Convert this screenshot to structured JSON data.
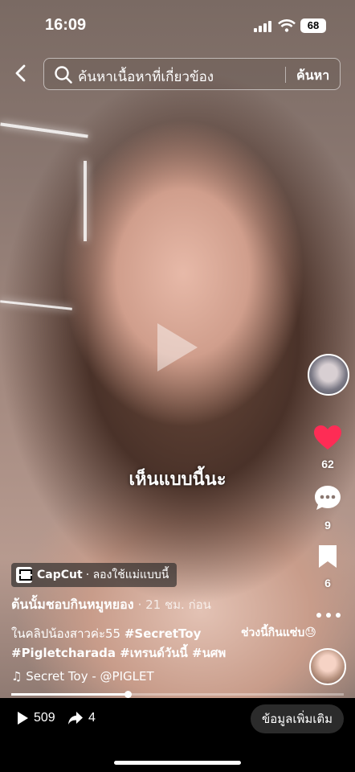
{
  "status_bar": {
    "time": "16:09",
    "battery": "68"
  },
  "search": {
    "placeholder": "ค้นหาเนื้อหาที่เกี่ยวข้อง",
    "submit_label": "ค้นหา"
  },
  "video": {
    "overlay_text": "เห็นแบบนี้นะ",
    "progress": 0.35
  },
  "actions": {
    "likes": "62",
    "comments": "9",
    "saves": "6"
  },
  "capcut": {
    "brand": "CapCut",
    "cta": "· ลองใช้แม่แบบนี้"
  },
  "post": {
    "author": "ต้นนั้มชอบกินหมูหยอง",
    "time": "· 21 ชม. ก่อน",
    "description_text": "ในคลิปน้องสาวค่ะ55 ",
    "hashtags_line1": "#SecretToy",
    "hashtags_line2": "#Pigletcharada #เทรนด์วันนี้  #นศพ",
    "comment_preview": "ช่วงนี้กินแซ่บ😓",
    "music": "♫ Secret Toy - @PIGLET"
  },
  "bottom_bar": {
    "views": "509",
    "shares": "4",
    "more_info_label": "ข้อมูลเพิ่มเติม"
  },
  "colors": {
    "like_red": "#FE2C55",
    "background": "#000000"
  },
  "icons": [
    "back-icon",
    "search-icon",
    "heart-icon",
    "comment-icon",
    "bookmark-icon",
    "more-icon",
    "capcut-icon",
    "play-icon",
    "share-icon",
    "signal-icon",
    "wifi-icon"
  ]
}
